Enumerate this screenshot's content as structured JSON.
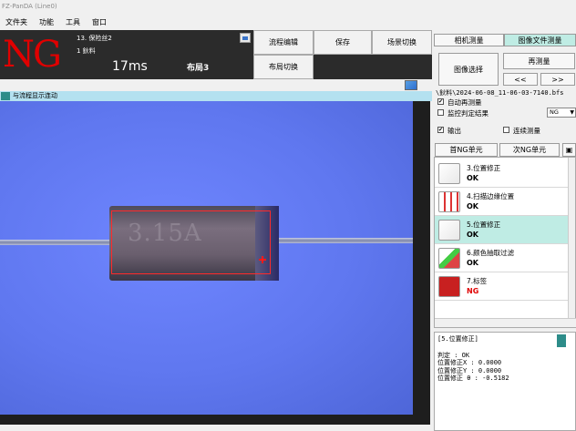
{
  "app": {
    "title": "FZ-PanDA (Line0)"
  },
  "menu": [
    "文件夹",
    "功能",
    "工具",
    "窗口"
  ],
  "status": {
    "judgement": "NG",
    "scene_name": "13. 保险丝2",
    "scene_number": "1 鈥料",
    "time": "17ms",
    "layout": "布局3"
  },
  "toolbar": {
    "flow_edit": "流程编辑",
    "save": "保存",
    "scene_switch": "场景切换",
    "layout_switch": "布局切换"
  },
  "image_window": {
    "title": "与流程显示连动",
    "print_text": "3.15A"
  },
  "right_panel": {
    "tab_camera": "相机测量",
    "tab_image_file": "图像文件测量",
    "image_select": "图像选择",
    "remeasure": "再测量",
    "prev": "<<",
    "next": ">>",
    "file_path": "\\鈥料\\2024-06-08_11-06-03-7140.bfs",
    "auto_remeasure": "自动再测量",
    "monitor_result": "监控判定结果",
    "monitor_value": "NG",
    "output": "输出",
    "continuous": "连续测量",
    "first_ng": "首NG单元",
    "next_ng": "次NG单元"
  },
  "units": [
    {
      "name": "3.位置修正",
      "result": "OK",
      "icon": "position-correction-icon"
    },
    {
      "name": "4.扫描边缘位置",
      "result": "OK",
      "icon": "edge-scan-icon"
    },
    {
      "name": "5.位置修正",
      "result": "OK",
      "icon": "position-correction-icon"
    },
    {
      "name": "6.颜色抽取过滤",
      "result": "OK",
      "icon": "color-filter-icon"
    },
    {
      "name": "7.标签",
      "result": "NG",
      "icon": "label-icon"
    }
  ],
  "detail": {
    "header": "[5.位置修正]",
    "judge": "判定   : OK",
    "pos_x": "位置修正X : 0.0000",
    "pos_y": "位置修正Y : 0.0000",
    "pos_theta": "位置修正 θ : -0.5182"
  },
  "colors": {
    "ng_red": "#e00000",
    "selected": "#bfece4",
    "teal": "#2d8c89",
    "image_bg": "#6f86ff"
  }
}
